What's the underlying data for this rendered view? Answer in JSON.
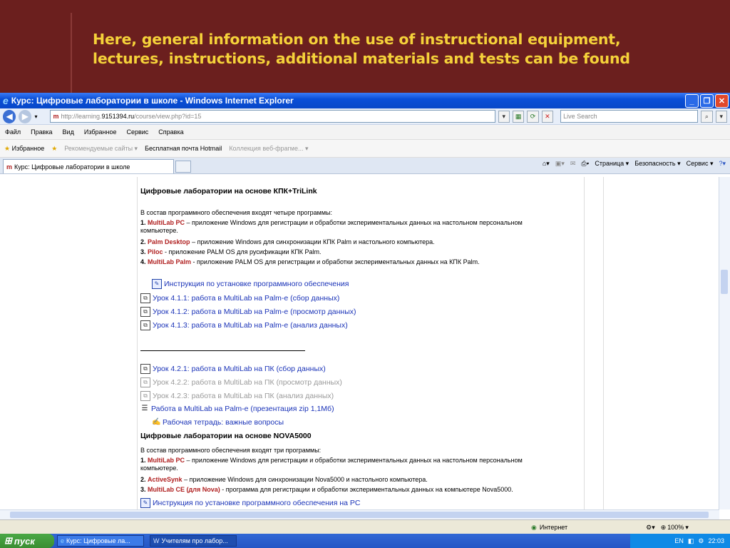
{
  "slide": {
    "title_line1": "Here, general information on the use of instructional equipment,",
    "title_line2": "lectures, instructions, additional materials and tests can be found"
  },
  "browser": {
    "window_title": "Курс: Цифровые лаборатории в школе - Windows Internet Explorer",
    "address_prefix": "http://learning.",
    "address_host": "9151394.ru",
    "address_path": "/course/view.php?id=15",
    "search_placeholder": "Live Search",
    "menu": [
      "Файл",
      "Правка",
      "Вид",
      "Избранное",
      "Сервис",
      "Справка"
    ],
    "favorites": {
      "label": "Избранное",
      "items": [
        "Рекомендуемые сайты ▾",
        "Бесплатная почта Hotmail",
        "Коллекция веб-фрагме... ▾"
      ]
    },
    "tab_label": "Курс: Цифровые лаборатории в школе",
    "cmd": {
      "page": "Страница ▾",
      "security": "Безопасность ▾",
      "service": "Сервис ▾"
    },
    "status": {
      "zone": "Интернет",
      "zoom": "100%"
    }
  },
  "content": {
    "section1": {
      "heading": "Цифровые лаборатории на основе КПК+TriLink",
      "intro": "В состав программного обеспечения входят четыре программы:",
      "items": [
        {
          "num": "1.",
          "name": "MultiLab PC",
          "text": " – приложение Windows для регистрации и обработки экспериментальных данных на настольном персональном"
        },
        {
          "num": "",
          "name": "",
          "text": "компьютере."
        },
        {
          "num": "2.",
          "name": "Palm Desktop",
          "text": " – приложение Windows для синхронизации КПК Palm и настольного компьютера."
        },
        {
          "num": "3.",
          "name": "Piloc",
          "text": " - приложение PALM OS для русификации КПК Palm."
        },
        {
          "num": "4.",
          "name": "MultiLab Palm",
          "text": " - приложение PALM OS для регистрации и обработки экспериментальных данных на КПК Palm."
        }
      ],
      "links": [
        {
          "label": "Инструкция по установке программного обеспечения",
          "icon": "doc"
        },
        {
          "label": "Урок 4.1.1: работа в MultiLab на Palm-е (сбор данных)",
          "icon": "lesson"
        },
        {
          "label": "Урок 4.1.2: работа в MultiLab на Palm-е (просмотр данных)",
          "icon": "lesson"
        },
        {
          "label": "Урок 4.1.3: работа в MultiLab на Palm-е (анализ данных)",
          "icon": "lesson"
        }
      ]
    },
    "section2_links": [
      {
        "label": "Урок 4.2.1: работа в MultiLab на ПК (сбор данных)",
        "icon": "lesson",
        "dim": false
      },
      {
        "label": "Урок 4.2.2: работа в MultiLab на ПК (просмотр данных)",
        "icon": "lesson",
        "dim": true
      },
      {
        "label": "Урок 4.2.3: работа в MultiLab на ПК (анализ данных)",
        "icon": "lesson",
        "dim": true
      },
      {
        "label": "Работа в MultiLab на Palm-е (презентация  zip 1,1Мб)",
        "icon": "archive",
        "dim": false
      },
      {
        "label": "Рабочая тетрадь: важные вопросы",
        "icon": "edit",
        "dim": false
      }
    ],
    "section3": {
      "heading": "Цифровые лаборатории на основе NOVA5000",
      "intro": "В состав программного обеспечения входят три программы:",
      "items": [
        {
          "num": "1.",
          "name": "MultiLab PC",
          "text": " – приложение Windows для регистрации и обработки экспериментальных данных на настольном персональном"
        },
        {
          "num": "",
          "name": "",
          "text": "компьютере."
        },
        {
          "num": "2.",
          "name": "ActiveSynk",
          "text": " – приложение Windows для синхронизации Nova5000 и настольного компьютера."
        },
        {
          "num": "3.",
          "name": "MultiLab CE (для Nova)",
          "text": " - программа для регистрации и обработки экспериментальных данных на компьютере Nova5000."
        }
      ],
      "link": "Инструкция по установке программного обеспечения на PC"
    }
  },
  "taskbar": {
    "start": "пуск",
    "tasks": [
      "Курс: Цифровые ла...",
      "Учителям про лабор..."
    ],
    "lang": "EN",
    "clock": "22:03"
  }
}
